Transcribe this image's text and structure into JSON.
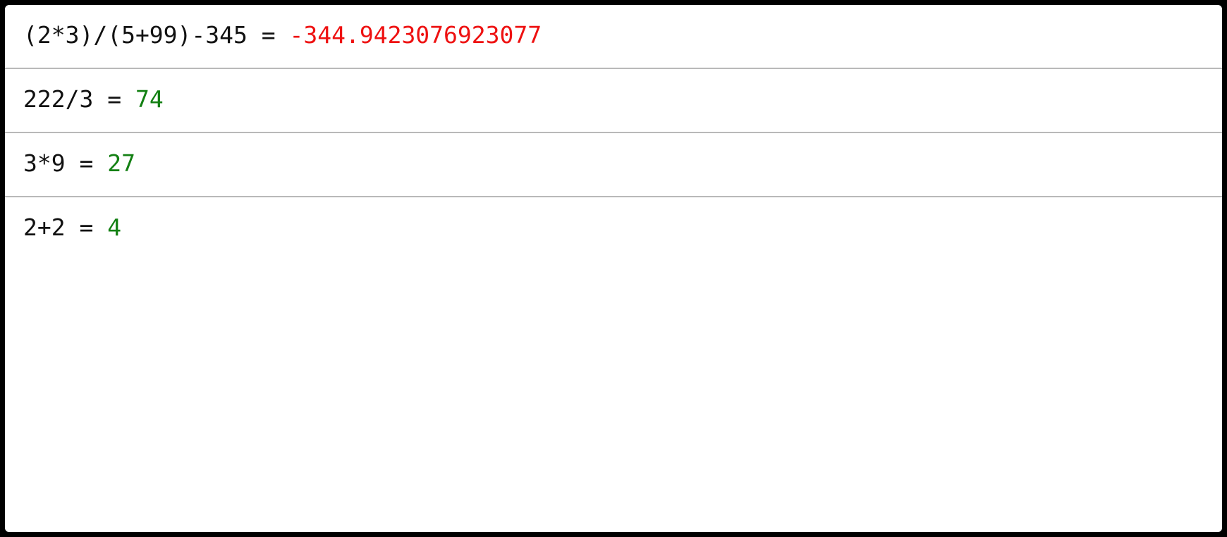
{
  "colors": {
    "error_result": "#ee1111",
    "ok_result": "#138013",
    "expression": "#111111",
    "divider": "#b9b9b9"
  },
  "history": [
    {
      "expression": "(2*3)/(5+99)-345",
      "equals": " = ",
      "result": "-344.9423076923077",
      "result_color": "#ee1111"
    },
    {
      "expression": "222/3",
      "equals": " = ",
      "result": "74",
      "result_color": "#138013"
    },
    {
      "expression": "3*9",
      "equals": " = ",
      "result": "27",
      "result_color": "#138013"
    },
    {
      "expression": "2+2",
      "equals": " = ",
      "result": "4",
      "result_color": "#138013"
    }
  ]
}
